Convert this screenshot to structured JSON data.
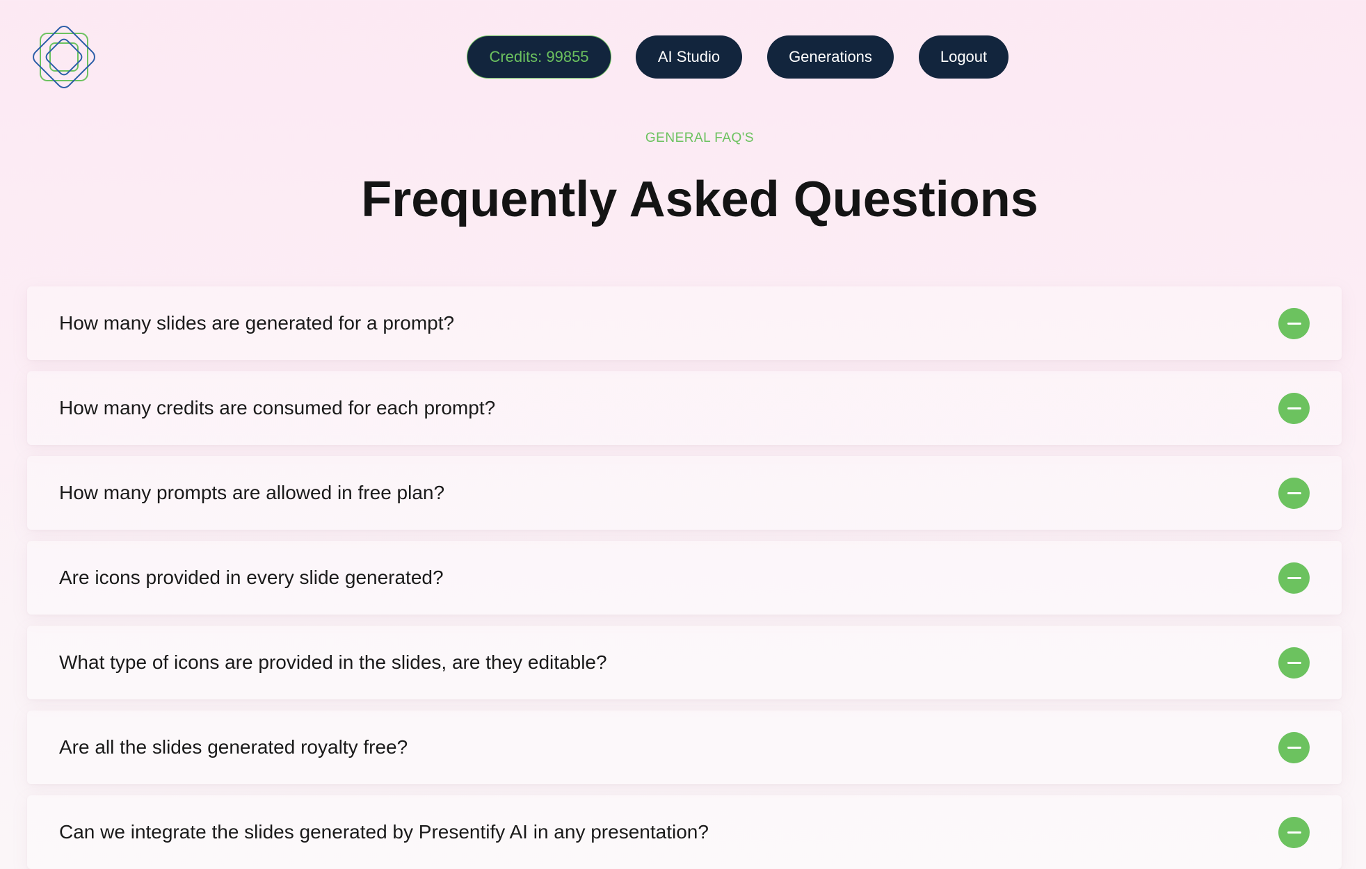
{
  "header": {
    "logo": "presentify-logo",
    "nav": {
      "credits_label": "Credits: 99855",
      "ai_studio_label": "AI Studio",
      "generations_label": "Generations",
      "logout_label": "Logout"
    }
  },
  "faq": {
    "eyebrow": "GENERAL FAQ'S",
    "title": "Frequently Asked Questions",
    "items": [
      {
        "question": "How many slides are generated for a prompt?",
        "icon": "minus-icon"
      },
      {
        "question": "How many credits are consumed for each prompt?",
        "icon": "minus-icon"
      },
      {
        "question": "How many prompts are allowed in free plan?",
        "icon": "minus-icon"
      },
      {
        "question": "Are icons provided in every slide generated?",
        "icon": "minus-icon"
      },
      {
        "question": "What type of icons are provided in the slides, are they editable?",
        "icon": "minus-icon"
      },
      {
        "question": "Are all the slides generated royalty free?",
        "icon": "minus-icon"
      },
      {
        "question": "Can we integrate the slides generated by Presentify AI in any presentation?",
        "icon": "minus-icon"
      }
    ]
  },
  "colors": {
    "accent_green": "#6cc25f",
    "nav_dark": "#12253d",
    "logo_blue": "#2d5fa8",
    "logo_green": "#6cc25f"
  }
}
